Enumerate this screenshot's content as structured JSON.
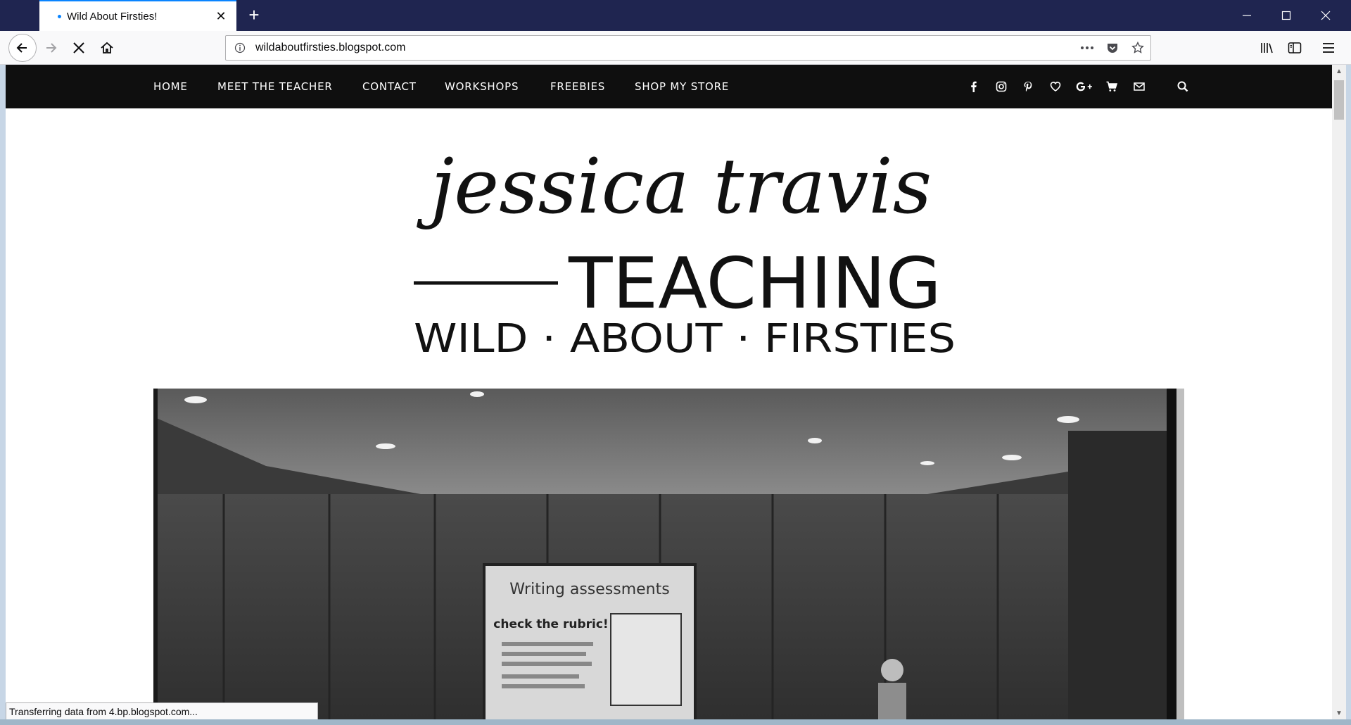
{
  "browser": {
    "tab": {
      "title": "Wild About Firsties!",
      "close_glyph": "✕"
    },
    "new_tab_glyph": "+",
    "url": "wildaboutfirsties.blogspot.com",
    "status_text": "Transferring data from 4.bp.blogspot.com...",
    "icons": [
      "back-icon",
      "forward-icon",
      "stop-icon",
      "home-icon",
      "info-icon",
      "more-icon",
      "pocket-icon",
      "bookmark-star-icon",
      "library-icon",
      "sidebar-icon",
      "hamburger-menu-icon",
      "minimize-icon",
      "maximize-icon",
      "close-icon"
    ]
  },
  "site": {
    "nav": [
      {
        "label": "HOME"
      },
      {
        "label": "MEET THE TEACHER"
      },
      {
        "label": "CONTACT"
      },
      {
        "label": "WORKSHOPS"
      },
      {
        "label": "FREEBIES"
      },
      {
        "label": "SHOP MY STORE"
      }
    ],
    "social_icons": [
      "facebook-icon",
      "instagram-icon",
      "pinterest-icon",
      "heart-icon",
      "google-plus-icon",
      "cart-icon",
      "mail-icon",
      "search-icon"
    ],
    "logo": {
      "script_line": "jessica travis",
      "main_line": "TEACHING",
      "sub_line": "WILD · ABOUT · FIRSTIES"
    },
    "hero": {
      "poster_title": "Writing assessments",
      "poster_heading": "check the rubric!"
    }
  },
  "colors": {
    "titlebar": "#1f2550",
    "accent": "#0a84ff",
    "site_nav_bg": "#0f0f0f",
    "page_bg": "#ffffff"
  }
}
